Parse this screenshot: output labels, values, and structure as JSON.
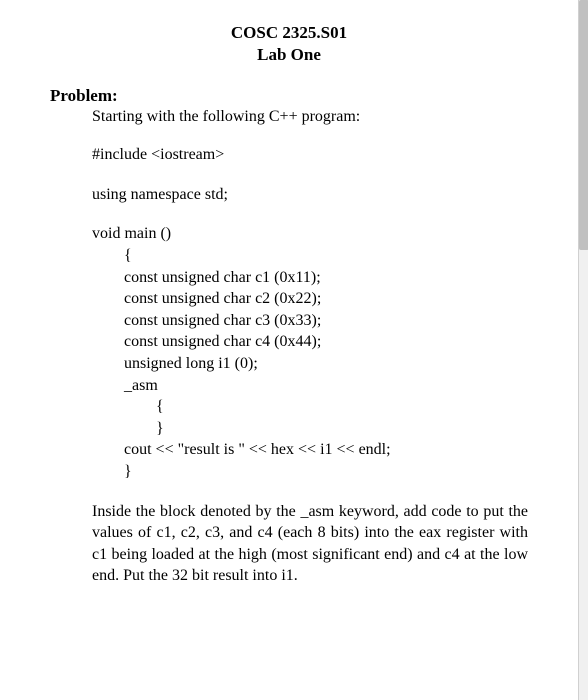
{
  "header": {
    "course": "COSC 2325.S01",
    "lab": "Lab One"
  },
  "section_label": "Problem:",
  "intro": "Starting with the following C++ program:",
  "code": {
    "include": "#include <iostream>",
    "using": "using namespace std;",
    "main_sig": "void main ()",
    "brace_open": "{",
    "c1": "const unsigned char c1 (0x11);",
    "c2": "const unsigned char c2 (0x22);",
    "c3": "const unsigned char c3 (0x33);",
    "c4": "const unsigned char c4 (0x44);",
    "i1": "unsigned long i1 (0);",
    "asm": "_asm",
    "asm_open": "{",
    "asm_close": "}",
    "cout": "cout << \"result is \" << hex << i1 << endl;",
    "brace_close": "}"
  },
  "instruction": "Inside the block denoted by the _asm keyword, add code to put the values of c1, c2, c3, and c4 (each 8 bits) into the eax register with c1 being loaded at the high (most significant end) and c4 at the low end. Put the 32 bit result into i1."
}
